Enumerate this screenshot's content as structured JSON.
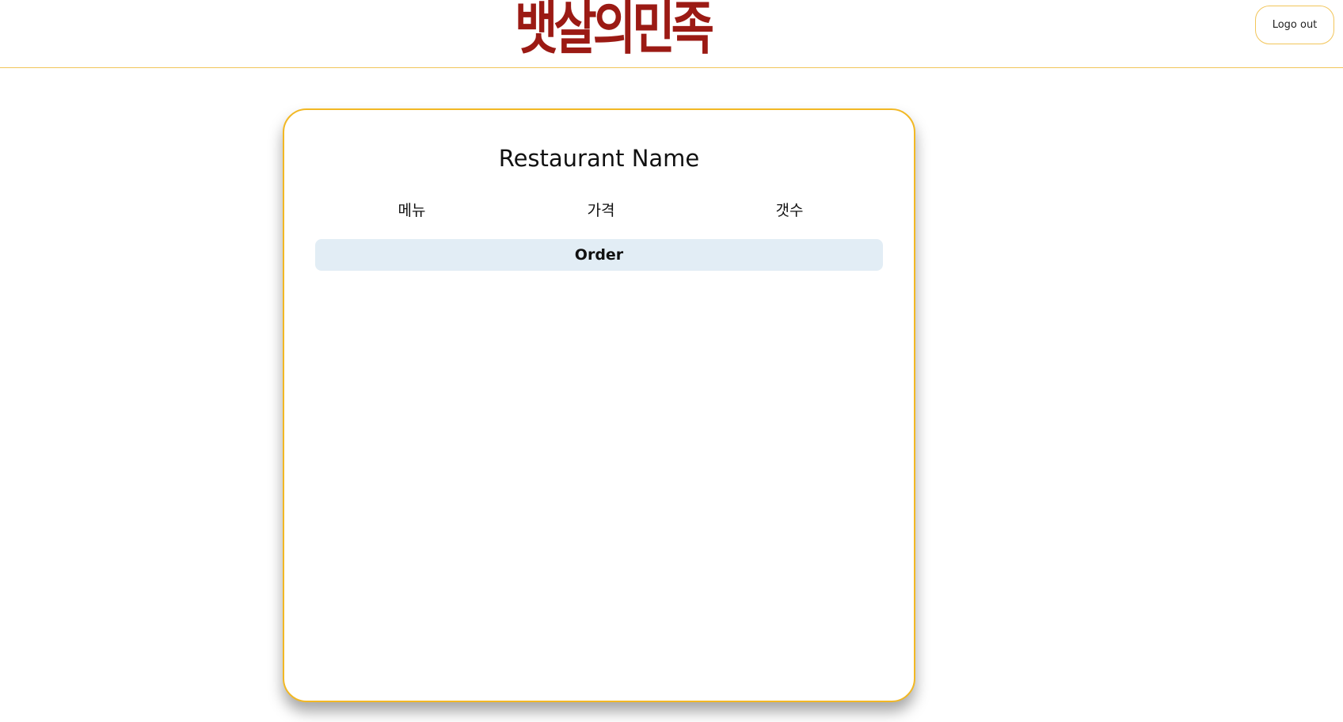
{
  "header": {
    "logo_text": "뱃살의민족",
    "logout_label": "Logo out"
  },
  "card": {
    "restaurant_name": "Restaurant Name",
    "columns": [
      "메뉴",
      "가격",
      "갯수"
    ],
    "order_label": "Order"
  },
  "colors": {
    "accent_border": "#f2b824",
    "logo": "#9b1a14",
    "order_button_bg": "#e2edf5"
  }
}
